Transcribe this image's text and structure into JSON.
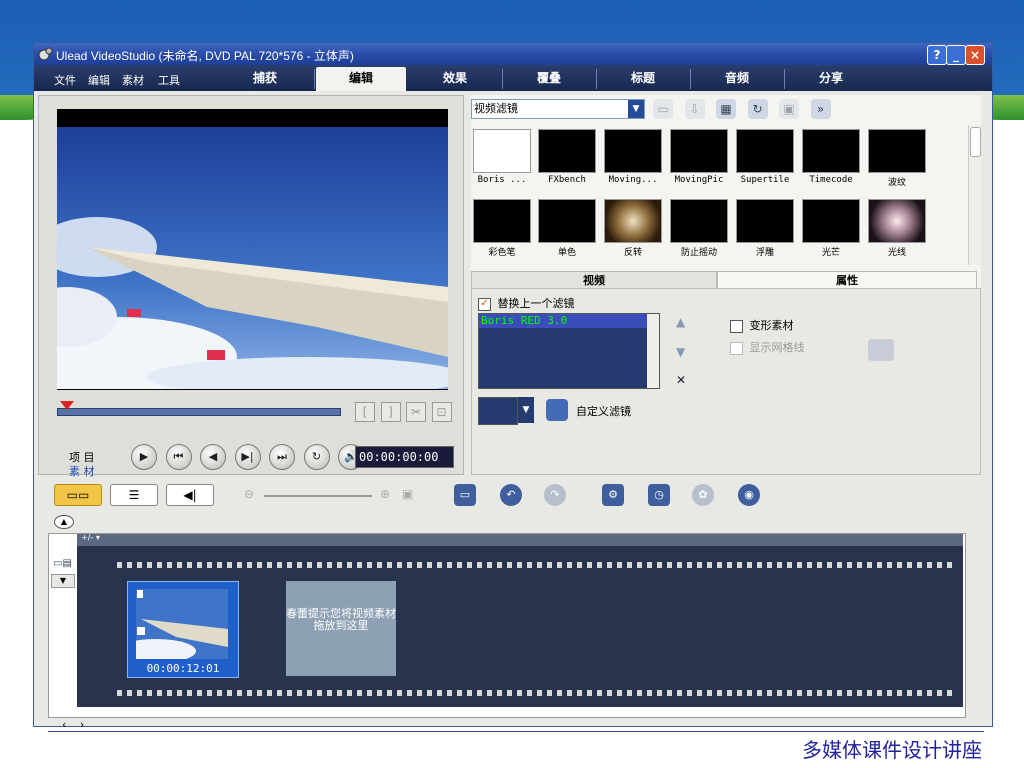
{
  "window": {
    "title": "Ulead VideoStudio (未命名, DVD PAL 720*576 - 立体声)",
    "controls": [
      "?",
      "_",
      "×"
    ]
  },
  "menu": [
    "文件",
    "编辑",
    "素材",
    "工具"
  ],
  "tabs": [
    {
      "label": "捕获",
      "selected": false
    },
    {
      "label": "编辑",
      "selected": true
    },
    {
      "label": "效果",
      "selected": false
    },
    {
      "label": "覆叠",
      "selected": false
    },
    {
      "label": "标题",
      "selected": false
    },
    {
      "label": "音频",
      "selected": false
    },
    {
      "label": "分享",
      "selected": false
    }
  ],
  "preview": {
    "mode_labels": {
      "project": "项 目",
      "clip": "素 材"
    },
    "timecode": "00:00:00:00",
    "trim_buttons": [
      "[",
      "]",
      "✂",
      "⊡"
    ],
    "playback_buttons": [
      "▶",
      "⏮",
      "◀",
      "▶|",
      "⏭",
      "↻",
      "🔊"
    ]
  },
  "library": {
    "category": "视频滤镜",
    "thumbnails": [
      {
        "label": "Boris ...",
        "style": "eagle"
      },
      {
        "label": "FXbench",
        "style": "cube"
      },
      {
        "label": "Moving...",
        "style": "black"
      },
      {
        "label": "MovingPic",
        "style": "black"
      },
      {
        "label": "Supertile",
        "style": "orange"
      },
      {
        "label": "Timecode",
        "style": "orange"
      },
      {
        "label": "波纹",
        "style": "cube2"
      },
      {
        "label": "彩色笔",
        "style": "cube2"
      },
      {
        "label": "单色",
        "style": "cube"
      },
      {
        "label": "反转",
        "style": "cube"
      },
      {
        "label": "防止摇动",
        "style": "cube2"
      },
      {
        "label": "浮雕",
        "style": "cube"
      },
      {
        "label": "光芒",
        "style": "cube2"
      },
      {
        "label": "光线",
        "style": "cube"
      }
    ]
  },
  "options": {
    "tabs": [
      "视频",
      "属性"
    ],
    "replace_last_filter": {
      "label": "替换上一个滤镜",
      "checked": true
    },
    "applied_filters": [
      "Boris RED 3.0"
    ],
    "distort_clip": {
      "label": "变形素材",
      "checked": false
    },
    "show_grid": {
      "label": "显示网格线",
      "checked": false,
      "enabled": false
    },
    "custom_filter_label": "自定义滤镜"
  },
  "timeline": {
    "clip_time": "00:00:12:01",
    "drop_hint": "春蕾提示您将视频素材拖放到这里",
    "track_marker": "+/- ▾"
  },
  "slide": {
    "caption": "多媒体课件设计讲座"
  }
}
